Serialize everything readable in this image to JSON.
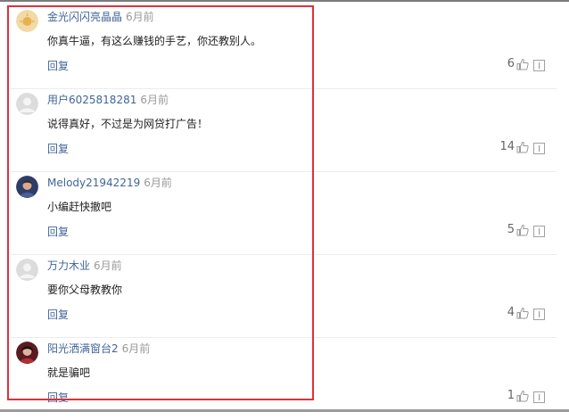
{
  "comments": [
    {
      "avatar": "avatar-sun",
      "username": "金光闪闪亮晶晶",
      "time": "6月前",
      "content": "你真牛逼，有这么赚钱的手艺，你还教别人。",
      "reply_label": "回复",
      "likes": "6"
    },
    {
      "avatar": "avatar-default",
      "username": "用户6025818281",
      "time": "6月前",
      "content": "说得真好，不过是为网贷打广告！",
      "reply_label": "回复",
      "likes": "14"
    },
    {
      "avatar": "avatar-photo-blue",
      "username": "Melody21942219",
      "time": "6月前",
      "content": "小编赶快撤吧",
      "reply_label": "回复",
      "likes": "5"
    },
    {
      "avatar": "avatar-default",
      "username": "万力木业",
      "time": "6月前",
      "content": "要你父母教教你",
      "reply_label": "回复",
      "likes": "4"
    },
    {
      "avatar": "avatar-photo-red",
      "username": "阳光洒满窗台2",
      "time": "6月前",
      "content": "就是骗吧",
      "reply_label": "回复",
      "likes": "1"
    }
  ],
  "icons": {
    "like": "thumbs-up-icon",
    "report": "report-icon"
  },
  "colors": {
    "username": "#406599",
    "highlight_border": "#e0303b",
    "time": "#999999"
  }
}
